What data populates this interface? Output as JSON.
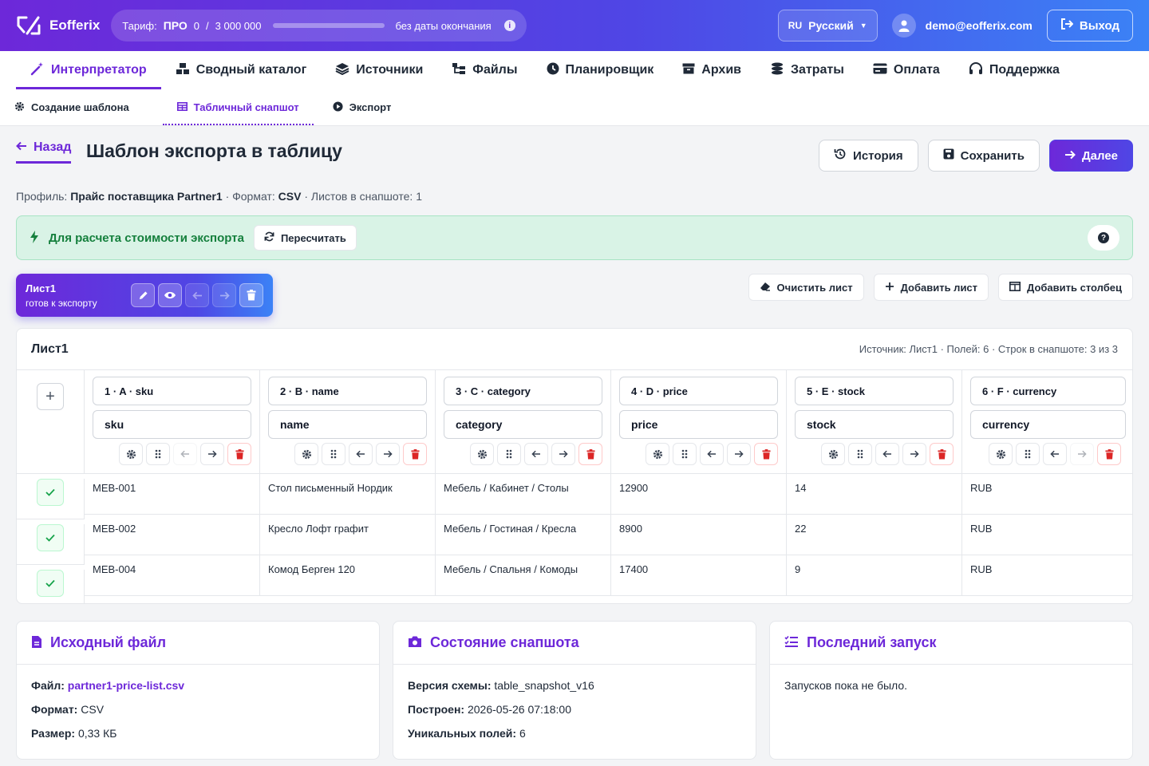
{
  "brand": {
    "name": "Eofferix"
  },
  "tariff": {
    "label": "Тариф:",
    "plan": "ПРО",
    "used": "0",
    "separator": "/",
    "limit": "3 000 000",
    "usage_fraction": 0.0,
    "expiry": "без даты окончания"
  },
  "language": {
    "code": "RU",
    "name": "Русский"
  },
  "user": {
    "email": "demo@eofferix.com"
  },
  "logout_label": "Выход",
  "nav": [
    {
      "label": "Интерпретатор",
      "icon": "magic-wand-icon"
    },
    {
      "label": "Сводный каталог",
      "icon": "boxes-icon"
    },
    {
      "label": "Источники",
      "icon": "layers-icon"
    },
    {
      "label": "Файлы",
      "icon": "file-tree-icon"
    },
    {
      "label": "Планировщик",
      "icon": "clock-icon"
    },
    {
      "label": "Архив",
      "icon": "archive-icon"
    },
    {
      "label": "Затраты",
      "icon": "coins-icon"
    },
    {
      "label": "Оплата",
      "icon": "card-icon"
    },
    {
      "label": "Поддержка",
      "icon": "headset-icon"
    }
  ],
  "subnav": [
    {
      "label": "Создание шаблона",
      "icon": "gear-icon"
    },
    {
      "label": "Табличный снапшот",
      "icon": "table-icon"
    },
    {
      "label": "Экспорт",
      "icon": "play-icon"
    }
  ],
  "page": {
    "back_label": "Назад",
    "title": "Шаблон экспорта в таблицу",
    "history_label": "История",
    "save_label": "Сохранить",
    "next_label": "Далее",
    "meta": {
      "profile_label": "Профиль:",
      "profile": "Прайс поставщика Partner1",
      "format_label": "· Формат:",
      "format": "CSV",
      "sheets": "· Листов в снапшоте: 1"
    }
  },
  "alert": {
    "text": "Для расчета стоимости экспорта",
    "recalc_label": "Пересчитать",
    "help": "?"
  },
  "sheet_tab": {
    "name": "Лист1",
    "status": "готов к экспорту"
  },
  "sheet_actions": {
    "clear": "Очистить лист",
    "add_sheet": "Добавить лист",
    "add_column": "Добавить столбец"
  },
  "table": {
    "title": "Лист1",
    "info": "Источник: Лист1 · Полей: 6 · Строк в снапшоте: 3 из 3",
    "plus": "+",
    "columns": [
      {
        "header": "1 · A · sku",
        "field": "sku"
      },
      {
        "header": "2 · B · name",
        "field": "name"
      },
      {
        "header": "3 · C · category",
        "field": "category"
      },
      {
        "header": "4 · D · price",
        "field": "price"
      },
      {
        "header": "5 · E · stock",
        "field": "stock"
      },
      {
        "header": "6 · F · currency",
        "field": "currency"
      }
    ],
    "rows": [
      [
        "MEB-001",
        "Стол письменный Нордик",
        "Мебель / Кабинет / Столы",
        "12900",
        "14",
        "RUB"
      ],
      [
        "MEB-002",
        "Кресло Лофт графит",
        "Мебель / Гостиная / Кресла",
        "8900",
        "22",
        "RUB"
      ],
      [
        "MEB-004",
        "Комод Берген 120",
        "Мебель / Спальня / Комоды",
        "17400",
        "9",
        "RUB"
      ]
    ]
  },
  "cards": {
    "source": {
      "title": "Исходный файл",
      "file_label": "Файл:",
      "file": "partner1-price-list.csv",
      "format_label": "Формат:",
      "format": "CSV",
      "size_label": "Размер:",
      "size": "0,33 КБ"
    },
    "snapshot": {
      "title": "Состояние снапшота",
      "schema_label": "Версия схемы:",
      "schema": "table_snapshot_v16",
      "built_label": "Построен:",
      "built": "2026-05-26 07:18:00",
      "fields_label": "Уникальных полей:",
      "fields": "6"
    },
    "last_run": {
      "title": "Последний запуск",
      "text": "Запусков пока не было."
    }
  },
  "colors": {
    "accent": "#6d28d9",
    "accent2": "#4f46e5",
    "success": "#15803d",
    "danger": "#dc2626"
  }
}
